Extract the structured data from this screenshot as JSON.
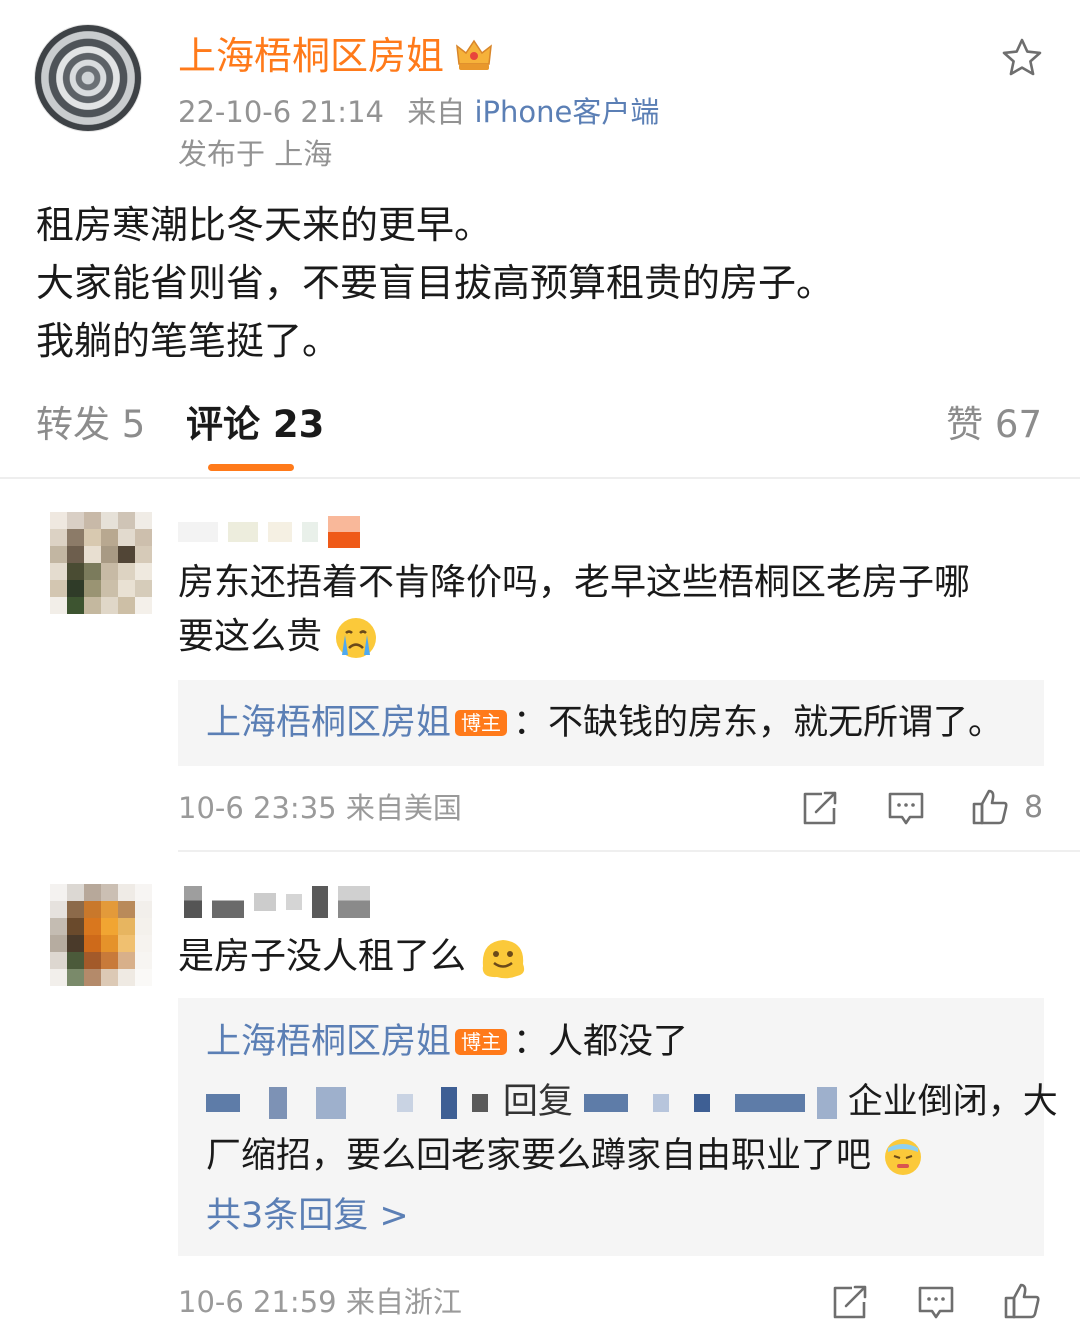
{
  "post": {
    "author": "上海梧桐区房姐",
    "time": "22-10-6 21:14",
    "source_prefix": "来自",
    "source": "iPhone客户端",
    "location": "发布于 上海",
    "body_lines": [
      "租房寒潮比冬天来的更早。",
      "大家能省则省，不要盲目拔高预算租贵的房子。",
      "我躺的笔笔挺了。"
    ]
  },
  "tabs": {
    "repost": "转发 5",
    "comment": "评论 23",
    "like": "赞 67"
  },
  "comments": [
    {
      "text_line1": "房东还捂着不肯降价吗，老早这些梧桐区老房子哪",
      "text_line2": "要这么贵",
      "reply_author": "上海梧桐区房姐",
      "reply_badge": "博主",
      "reply_text": "：不缺钱的房东，就无所谓了。",
      "meta": "10-6 23:35 来自美国",
      "likes": "8"
    },
    {
      "text": "是房子没人租了么",
      "reply_author": "上海梧桐区房姐",
      "reply_badge": "博主",
      "reply_text": "：人都没了",
      "sub_reply_fragment": "回复",
      "sub_reply_tail": "企业倒闭，大",
      "sub_reply_line2": "厂缩招，要么回老家要么蹲家自由职业了吧",
      "more_replies": "共3条回复 >",
      "meta": "10-6 21:59 来自浙江"
    }
  ],
  "icons": {
    "crown": "crown-icon",
    "star": "star-icon",
    "share": "share-icon",
    "comment": "comment-icon",
    "like": "thumbs-up-icon"
  },
  "colors": {
    "accent": "#ff7a1a",
    "link": "#5b7fb5",
    "muted": "#939393"
  }
}
